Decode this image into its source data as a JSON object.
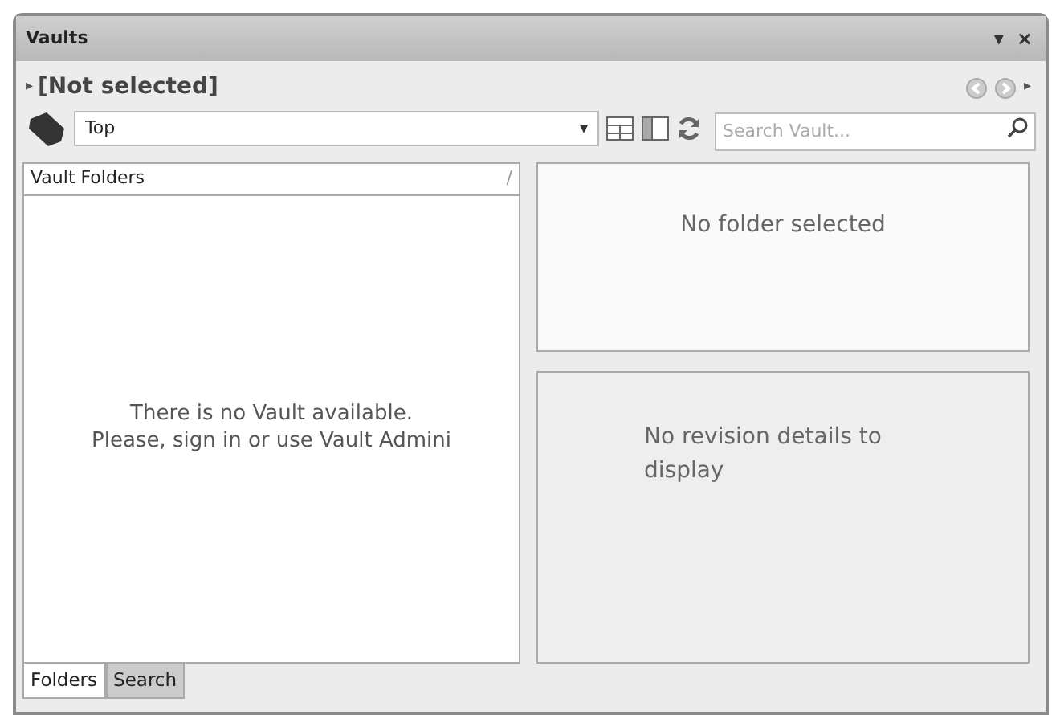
{
  "window": {
    "title": "Vaults",
    "controls": [
      "▾",
      "×"
    ]
  },
  "header": {
    "expander": "▸",
    "title": "[Not selected]",
    "nav_more": "▸"
  },
  "toolbar": {
    "folder": "Top",
    "dropdown": "▾",
    "search": {
      "placeholder": "Search Vault..."
    }
  },
  "folders_panel": {
    "title": "Vault Folders",
    "pin": "/",
    "message_lines": [
      "There is no Vault available.",
      "Please, sign in or use Vault Admini"
    ]
  },
  "tabs": [
    {
      "label": "Folders",
      "selected": true
    },
    {
      "label": "Search",
      "selected": false
    }
  ],
  "folder_view": {
    "message": "No folder selected"
  },
  "revision_view": {
    "message": "No revision details to display"
  }
}
